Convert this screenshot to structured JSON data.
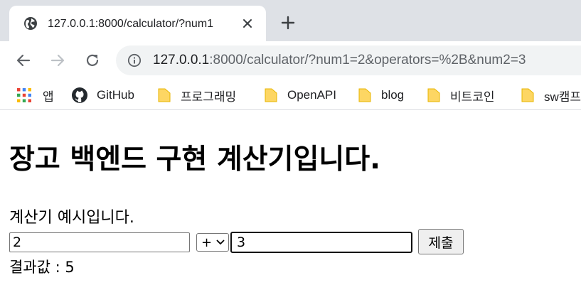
{
  "browser": {
    "tab": {
      "title": "127.0.0.1:8000/calculator/?num1",
      "favicon": "globe-icon",
      "close_icon": "close-icon"
    },
    "new_tab_icon": "plus-icon",
    "nav": {
      "back_icon": "back-arrow-icon",
      "forward_icon": "forward-arrow-icon",
      "reload_icon": "reload-icon"
    },
    "address": {
      "info_icon": "info-icon",
      "host": "127.0.0.1",
      "rest": ":8000/calculator/?num1=2&operators=%2B&num2=3"
    },
    "bookmarks": [
      {
        "label": "앱",
        "icon": "apps-grid-icon"
      },
      {
        "label": "GitHub",
        "icon": "github-icon"
      },
      {
        "label": "프로그래밍",
        "icon": "folder-icon"
      },
      {
        "label": "OpenAPI",
        "icon": "folder-icon"
      },
      {
        "label": "blog",
        "icon": "folder-icon"
      },
      {
        "label": "비트코인",
        "icon": "folder-icon"
      },
      {
        "label": "sw캠프",
        "icon": "folder-icon"
      }
    ],
    "colors": {
      "tabstrip": "#dee1e6",
      "omnibox": "#f1f3f4",
      "folder": "#fdd663"
    }
  },
  "page": {
    "heading": "장고 백엔드 구현 계산기입니다.",
    "description": "계산기 예시입니다.",
    "form": {
      "num1_value": "2",
      "operator_selected": "+",
      "num2_value": "3",
      "submit_label": "제출"
    },
    "result_label": "결과값 : 5"
  }
}
